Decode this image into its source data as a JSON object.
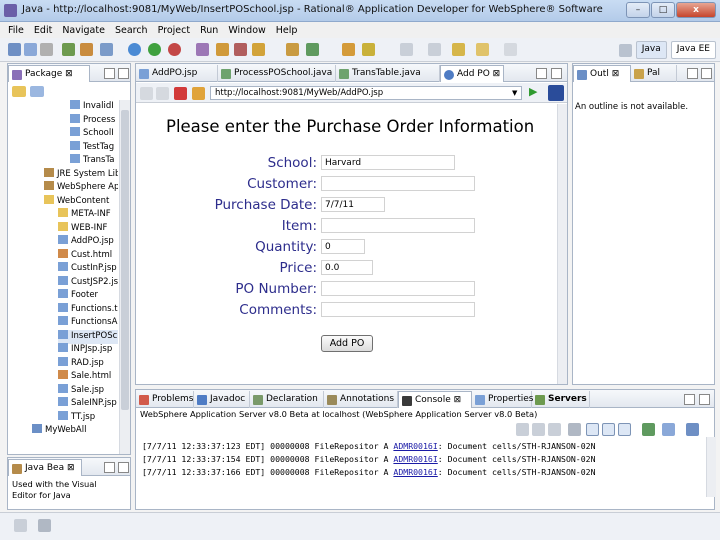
{
  "window": {
    "title": "Java - http://localhost:9081/MyWeb/InsertPOSchool.jsp - Rational® Application Developer for WebSphere® Software",
    "buttons": {
      "minimize": "–",
      "maximize": "□",
      "close": "x"
    }
  },
  "menu": [
    "File",
    "Edit",
    "Navigate",
    "Search",
    "Project",
    "Run",
    "Window",
    "Help"
  ],
  "perspectives": {
    "java": "Java",
    "javaee": "Java EE"
  },
  "package_explorer": {
    "tab": "Package",
    "items": [
      {
        "label": "InvalidI",
        "icon": "jsp-file-icon"
      },
      {
        "label": "Process",
        "icon": "jsp-file-icon"
      },
      {
        "label": "SchoolI",
        "icon": "jsp-file-icon"
      },
      {
        "label": "TestTag",
        "icon": "jsp-file-icon"
      },
      {
        "label": "TransTa",
        "icon": "jsp-file-icon"
      },
      {
        "label": "JRE System Lib",
        "icon": "library-icon"
      },
      {
        "label": "WebSphere Ap",
        "icon": "library-icon"
      },
      {
        "label": "WebContent",
        "icon": "folder-icon"
      },
      {
        "label": "META-INF",
        "icon": "folder-icon"
      },
      {
        "label": "WEB-INF",
        "icon": "folder-icon"
      },
      {
        "label": "AddPO.jsp",
        "icon": "jsp-file-icon"
      },
      {
        "label": "Cust.html",
        "icon": "html-file-icon"
      },
      {
        "label": "CustInP.jsp",
        "icon": "jsp-file-icon"
      },
      {
        "label": "CustJSP2.jsp",
        "icon": "jsp-file-icon"
      },
      {
        "label": "Footer",
        "icon": "jsp-file-icon"
      },
      {
        "label": "Functions.t",
        "icon": "jsp-file-icon"
      },
      {
        "label": "FunctionsA",
        "icon": "jsp-file-icon"
      },
      {
        "label": "InsertPOScl",
        "icon": "jsp-file-icon"
      },
      {
        "label": "INPJsp.jsp",
        "icon": "jsp-file-icon"
      },
      {
        "label": "RAD.jsp",
        "icon": "jsp-file-icon"
      },
      {
        "label": "Sale.html",
        "icon": "html-file-icon"
      },
      {
        "label": "Sale.jsp",
        "icon": "jsp-file-icon"
      },
      {
        "label": "SaleINP.jsp",
        "icon": "jsp-file-icon"
      },
      {
        "label": "TT.jsp",
        "icon": "jsp-file-icon"
      },
      {
        "label": "MyWebAll",
        "icon": "project-icon"
      }
    ]
  },
  "java_beans": {
    "tab": "Java Bea",
    "text": "Used with the Visual Editor for Java"
  },
  "editor": {
    "tabs": [
      "AddPO.jsp",
      "ProcessPOSchool.java",
      "TransTable.java",
      "Add PO"
    ],
    "url": "http://localhost:9081/MyWeb/AddPO.jsp",
    "heading": "Please enter the Purchase Order Information",
    "form": [
      {
        "label": "School:",
        "value": "Harvard"
      },
      {
        "label": "Customer:",
        "value": ""
      },
      {
        "label": "Purchase Date:",
        "value": "7/7/11"
      },
      {
        "label": "Item:",
        "value": ""
      },
      {
        "label": "Quantity:",
        "value": "0"
      },
      {
        "label": "Price:",
        "value": "0.0"
      },
      {
        "label": "PO Number:",
        "value": ""
      },
      {
        "label": "Comments:",
        "value": ""
      }
    ],
    "submit": "Add PO"
  },
  "outline": {
    "tabs": [
      "Outl",
      "Pal"
    ],
    "message": "An outline is not available."
  },
  "bottom": {
    "tabs": [
      "Problems",
      "Javadoc",
      "Declaration",
      "Annotations",
      "Console",
      "Properties",
      "Servers"
    ],
    "console_title": "WebSphere Application Server v8.0 Beta at localhost (WebSphere Application Server v8.0 Beta)",
    "lines": [
      {
        "pre": "[7/7/11 12:33:37:123 EDT] 00000008 FileRepositor A  ",
        "code": "ADMR0016I",
        "post": ": Document cells/STH-RJANSON-02N"
      },
      {
        "pre": "[7/7/11 12:33:37:154 EDT] 00000008 FileRepositor A  ",
        "code": "ADMR0016I",
        "post": ": Document cells/STH-RJANSON-02N"
      },
      {
        "pre": "[7/7/11 12:33:37:166 EDT] 00000008 FileRepositor A  ",
        "code": "ADMR0016I",
        "post": ": Document cells/STH-RJANSON-02N"
      }
    ]
  },
  "colors": {
    "accent": "#2d2d8c",
    "panel_border": "#a9b5c6",
    "titlebar": "#c9dcf3"
  }
}
